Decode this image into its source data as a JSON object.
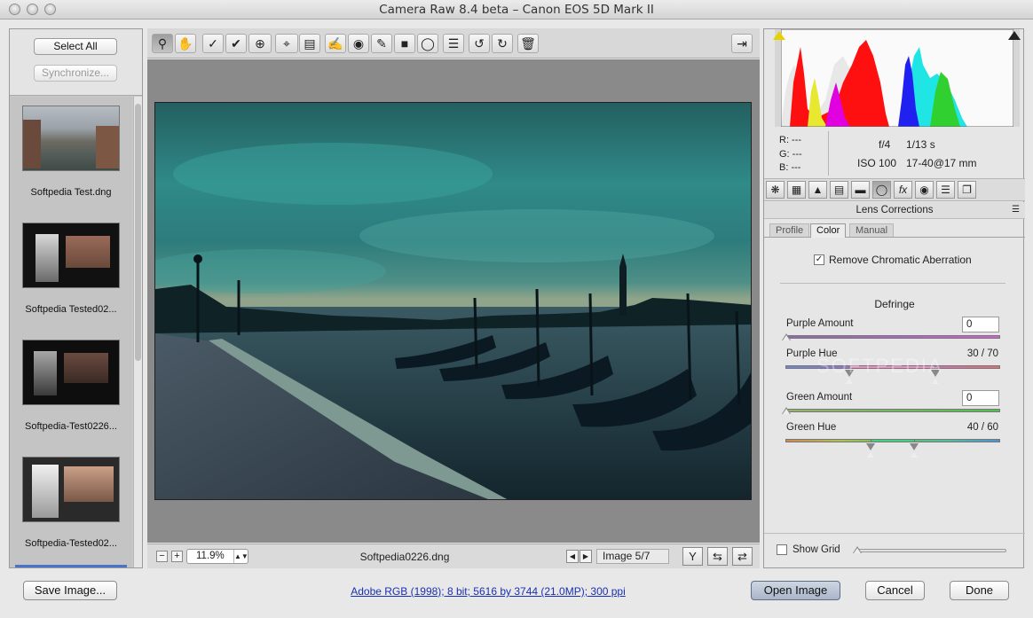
{
  "window": {
    "title": "Camera Raw 8.4 beta  –  Canon EOS 5D Mark II"
  },
  "filmstrip": {
    "select_all": "Select All",
    "synchronize": "Synchronize...",
    "items": [
      {
        "label": "Softpedia Test.dng"
      },
      {
        "label": "Softpedia Tested02..."
      },
      {
        "label": "Softpedia-Test0226..."
      },
      {
        "label": "Softpedia-Tested02..."
      }
    ]
  },
  "toolbar": {
    "tools": [
      "zoom-icon",
      "hand-icon",
      "white-balance-icon",
      "color-sampler-icon",
      "targeted-adjustment-icon",
      "crop-icon",
      "straighten-icon",
      "spot-removal-icon",
      "red-eye-icon",
      "adjustment-brush-icon",
      "graduated-filter-icon",
      "radial-filter-icon",
      "preferences-icon",
      "rotate-ccw-icon",
      "rotate-cw-icon",
      "trash-icon",
      "fullscreen-icon"
    ]
  },
  "status": {
    "zoom": "11.9%",
    "filename": "Softpedia0226.dng",
    "image_count": "Image 5/7"
  },
  "histogram": {
    "r": "R:   ---",
    "g": "G:   ---",
    "b": "B:   ---",
    "aperture": "f/4",
    "shutter": "1/13 s",
    "iso": "ISO 100",
    "lens": "17-40@17 mm"
  },
  "panel": {
    "title": "Lens Corrections",
    "tabs": [
      "Profile",
      "Color",
      "Manual"
    ],
    "active_tab": "Color",
    "remove_ca_label": "Remove Chromatic Aberration",
    "remove_ca_checked": true,
    "defringe_label": "Defringe",
    "purple_amount_label": "Purple Amount",
    "purple_amount_value": "0",
    "purple_hue_label": "Purple Hue",
    "purple_hue_value": "30 / 70",
    "green_amount_label": "Green Amount",
    "green_amount_value": "0",
    "green_hue_label": "Green Hue",
    "green_hue_value": "40 / 60",
    "show_grid_label": "Show Grid"
  },
  "footer": {
    "save": "Save Image...",
    "workflow": "Adobe RGB (1998); 8 bit; 5616 by 3744 (21.0MP); 300 ppi",
    "open": "Open Image",
    "cancel": "Cancel",
    "done": "Done"
  },
  "watermark": "SOFTPEDIA"
}
